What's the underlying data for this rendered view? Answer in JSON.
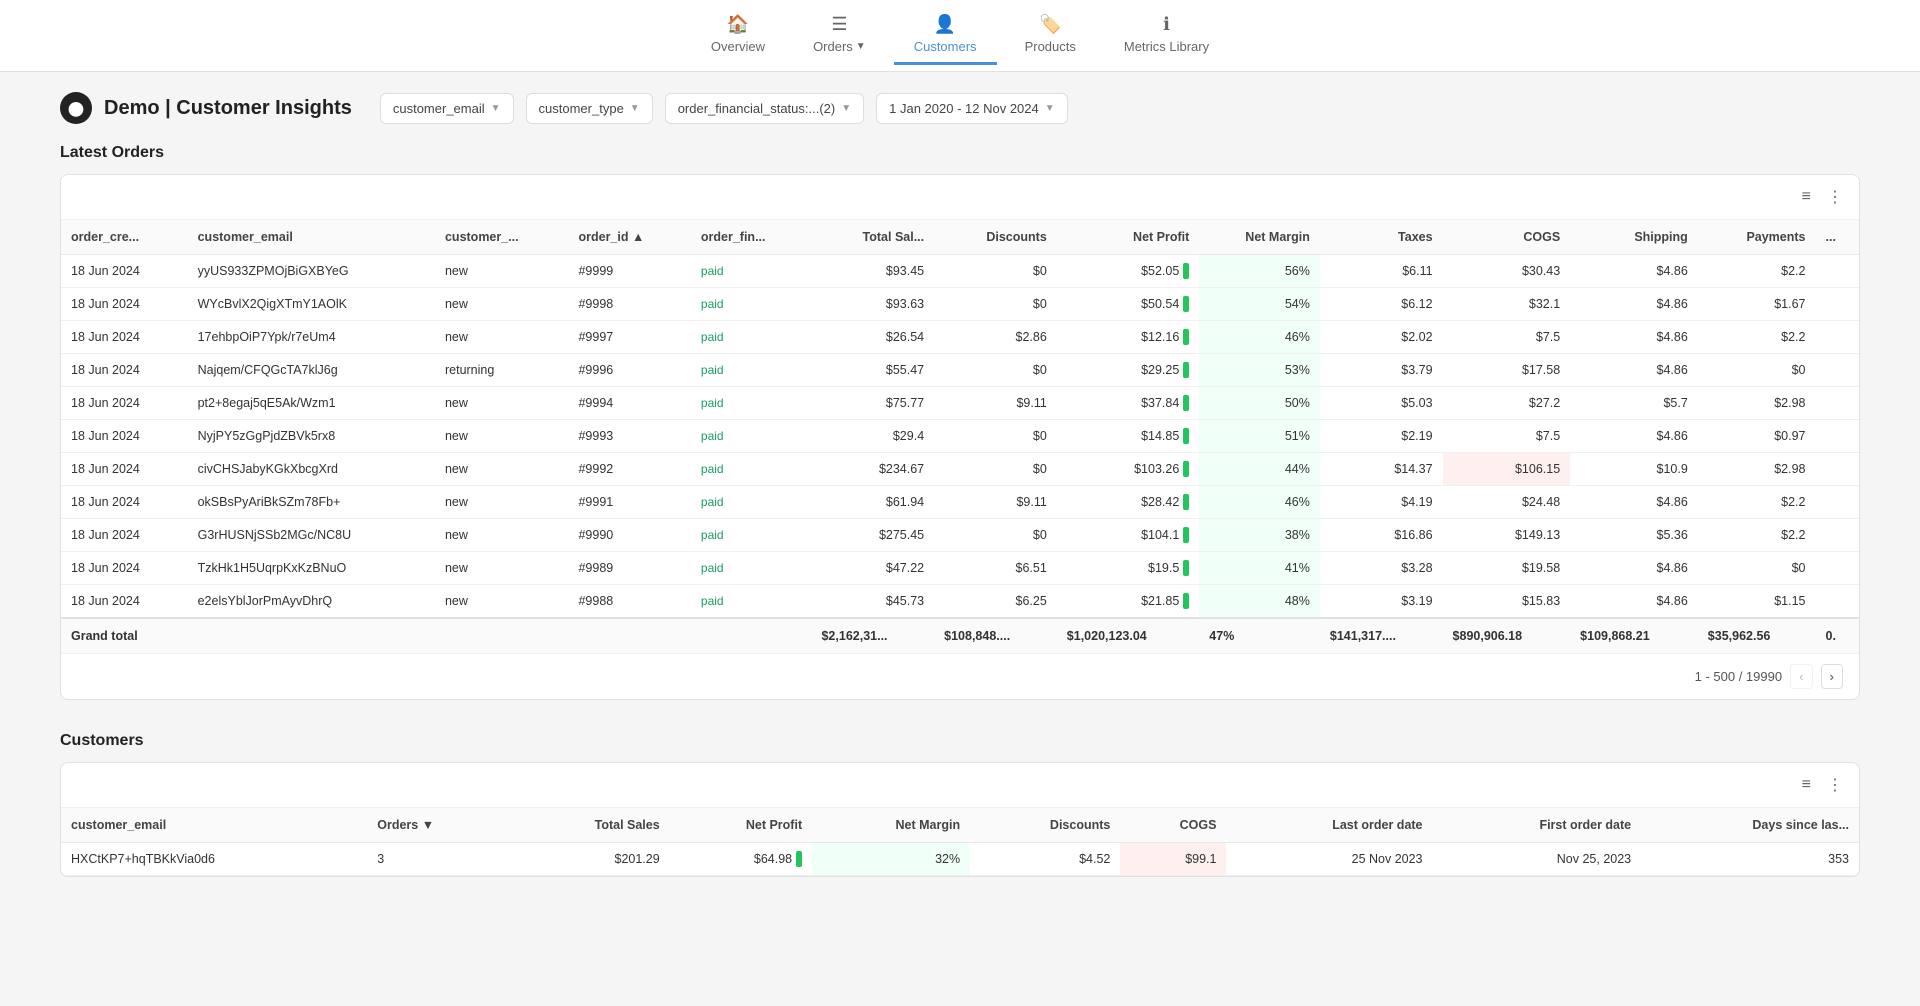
{
  "nav": {
    "items": [
      {
        "id": "overview",
        "label": "Overview",
        "icon": "🏠",
        "active": false
      },
      {
        "id": "orders",
        "label": "Orders",
        "icon": "≡",
        "active": false,
        "hasDropdown": true
      },
      {
        "id": "customers",
        "label": "Customers",
        "icon": "👤",
        "active": true
      },
      {
        "id": "products",
        "label": "Products",
        "icon": "🏷️",
        "active": false
      },
      {
        "id": "metrics-library",
        "label": "Metrics Library",
        "icon": "ℹ",
        "active": false
      }
    ]
  },
  "header": {
    "logo": "⬤",
    "title": "Demo | Customer Insights",
    "filters": [
      {
        "id": "customer_email",
        "label": "customer_email"
      },
      {
        "id": "customer_type",
        "label": "customer_type"
      },
      {
        "id": "order_financial_status",
        "label": "order_financial_status:...(2)"
      },
      {
        "id": "date_range",
        "label": "1 Jan 2020 - 12 Nov 2024"
      }
    ]
  },
  "latest_orders": {
    "section_title": "Latest Orders",
    "toolbar": {
      "filter_icon": "≡",
      "more_icon": "⋮"
    },
    "columns": [
      {
        "id": "order_cre",
        "label": "order_cre..."
      },
      {
        "id": "customer_email",
        "label": "customer_email"
      },
      {
        "id": "customer_type",
        "label": "customer_..."
      },
      {
        "id": "order_id",
        "label": "order_id",
        "sortable": true
      },
      {
        "id": "order_fin",
        "label": "order_fin..."
      },
      {
        "id": "total_sales",
        "label": "Total Sal...",
        "right": true
      },
      {
        "id": "discounts",
        "label": "Discounts",
        "right": true
      },
      {
        "id": "net_profit",
        "label": "Net Profit",
        "right": true
      },
      {
        "id": "net_margin",
        "label": "Net Margin",
        "right": true
      },
      {
        "id": "taxes",
        "label": "Taxes",
        "right": true
      },
      {
        "id": "cogs",
        "label": "COGS",
        "right": true
      },
      {
        "id": "shipping",
        "label": "Shipping",
        "right": true
      },
      {
        "id": "payments",
        "label": "Payments",
        "right": true
      },
      {
        "id": "more",
        "label": "..."
      }
    ],
    "rows": [
      {
        "date": "18 Jun 2024",
        "email": "yyUS933ZPMOjBiGXBYeG",
        "type": "new",
        "order_id": "#9999",
        "fin_status": "paid",
        "total_sales": "$93.45",
        "discounts": "$0",
        "net_profit": "$52.05",
        "net_margin": "56%",
        "taxes": "$6.11",
        "cogs": "$30.43",
        "shipping": "$4.86",
        "payments": "$2.2",
        "bar": true
      },
      {
        "date": "18 Jun 2024",
        "email": "WYcBvlX2QigXTmY1AOlK",
        "type": "new",
        "order_id": "#9998",
        "fin_status": "paid",
        "total_sales": "$93.63",
        "discounts": "$0",
        "net_profit": "$50.54",
        "net_margin": "54%",
        "taxes": "$6.12",
        "cogs": "$32.1",
        "shipping": "$4.86",
        "payments": "$1.67",
        "bar": true
      },
      {
        "date": "18 Jun 2024",
        "email": "17ehbpOiP7Ypk/r7eUm4",
        "type": "new",
        "order_id": "#9997",
        "fin_status": "paid",
        "total_sales": "$26.54",
        "discounts": "$2.86",
        "net_profit": "$12.16",
        "net_margin": "46%",
        "taxes": "$2.02",
        "cogs": "$7.5",
        "shipping": "$4.86",
        "payments": "$2.2",
        "bar": true
      },
      {
        "date": "18 Jun 2024",
        "email": "Najqem/CFQGcTA7klJ6g",
        "type": "returning",
        "order_id": "#9996",
        "fin_status": "paid",
        "total_sales": "$55.47",
        "discounts": "$0",
        "net_profit": "$29.25",
        "net_margin": "53%",
        "taxes": "$3.79",
        "cogs": "$17.58",
        "shipping": "$4.86",
        "payments": "$0",
        "bar": true
      },
      {
        "date": "18 Jun 2024",
        "email": "pt2+8egaj5qE5Ak/Wzm1",
        "type": "new",
        "order_id": "#9994",
        "fin_status": "paid",
        "total_sales": "$75.77",
        "discounts": "$9.11",
        "net_profit": "$37.84",
        "net_margin": "50%",
        "taxes": "$5.03",
        "cogs": "$27.2",
        "shipping": "$5.7",
        "payments": "$2.98",
        "bar": true
      },
      {
        "date": "18 Jun 2024",
        "email": "NyjPY5zGgPjdZBVk5rx8",
        "type": "new",
        "order_id": "#9993",
        "fin_status": "paid",
        "total_sales": "$29.4",
        "discounts": "$0",
        "net_profit": "$14.85",
        "net_margin": "51%",
        "taxes": "$2.19",
        "cogs": "$7.5",
        "shipping": "$4.86",
        "payments": "$0.97",
        "bar": true
      },
      {
        "date": "18 Jun 2024",
        "email": "civCHSJabyKGkXbcgXrd",
        "type": "new",
        "order_id": "#9992",
        "fin_status": "paid",
        "total_sales": "$234.67",
        "discounts": "$0",
        "net_profit": "$103.26",
        "net_margin": "44%",
        "taxes": "$14.37",
        "cogs": "$106.15",
        "shipping": "$10.9",
        "payments": "$2.98",
        "bar": true,
        "cogs_highlight": true
      },
      {
        "date": "18 Jun 2024",
        "email": "okSBsPyAriBkSZm78Fb+",
        "type": "new",
        "order_id": "#9991",
        "fin_status": "paid",
        "total_sales": "$61.94",
        "discounts": "$9.11",
        "net_profit": "$28.42",
        "net_margin": "46%",
        "taxes": "$4.19",
        "cogs": "$24.48",
        "shipping": "$4.86",
        "payments": "$2.2",
        "bar": true
      },
      {
        "date": "18 Jun 2024",
        "email": "G3rHUSNjSSb2MGc/NC8U",
        "type": "new",
        "order_id": "#9990",
        "fin_status": "paid",
        "total_sales": "$275.45",
        "discounts": "$0",
        "net_profit": "$104.1",
        "net_margin": "38%",
        "taxes": "$16.86",
        "cogs": "$149.13",
        "shipping": "$5.36",
        "payments": "$2.2",
        "bar": true
      },
      {
        "date": "18 Jun 2024",
        "email": "TzkHk1H5UqrpKxKzBNuO",
        "type": "new",
        "order_id": "#9989",
        "fin_status": "paid",
        "total_sales": "$47.22",
        "discounts": "$6.51",
        "net_profit": "$19.5",
        "net_margin": "41%",
        "taxes": "$3.28",
        "cogs": "$19.58",
        "shipping": "$4.86",
        "payments": "$0",
        "bar": true
      },
      {
        "date": "18 Jun 2024",
        "email": "e2elsYblJorPmAyvDhrQ",
        "type": "new",
        "order_id": "#9988",
        "fin_status": "paid",
        "total_sales": "$45.73",
        "discounts": "$6.25",
        "net_profit": "$21.85",
        "net_margin": "48%",
        "taxes": "$3.19",
        "cogs": "$15.83",
        "shipping": "$4.86",
        "payments": "$1.15",
        "bar": true
      }
    ],
    "grand_total": {
      "label": "Grand total",
      "total_sales": "$2,162,31...",
      "discounts": "$108,848....",
      "net_profit": "$1,020,123.04",
      "net_margin": "47%",
      "taxes": "$141,317....",
      "cogs": "$890,906.18",
      "shipping": "$109,868.21",
      "payments": "$35,962.56",
      "extra": "0."
    },
    "pagination": {
      "info": "1 - 500 / 19990",
      "prev_label": "‹",
      "next_label": "›"
    }
  },
  "customers": {
    "section_title": "Customers",
    "toolbar": {
      "filter_icon": "≡",
      "more_icon": "⋮"
    },
    "columns": [
      {
        "id": "customer_email",
        "label": "customer_email"
      },
      {
        "id": "orders",
        "label": "Orders",
        "sortable": true
      },
      {
        "id": "total_sales",
        "label": "Total Sales",
        "right": true
      },
      {
        "id": "net_profit",
        "label": "Net Profit",
        "right": true
      },
      {
        "id": "net_margin",
        "label": "Net Margin",
        "right": true
      },
      {
        "id": "discounts",
        "label": "Discounts",
        "right": true
      },
      {
        "id": "cogs",
        "label": "COGS",
        "right": true
      },
      {
        "id": "last_order_date",
        "label": "Last order date",
        "right": true
      },
      {
        "id": "first_order_date",
        "label": "First order date",
        "right": true
      },
      {
        "id": "days_since_last",
        "label": "Days since las...",
        "right": true
      }
    ],
    "rows": [
      {
        "email": "HXCtKP7+hqTBKkVia0d6",
        "orders": "3",
        "total_sales": "$201.29",
        "net_profit": "$64.98",
        "net_margin": "32%",
        "discounts": "$4.52",
        "cogs": "$99.1",
        "last_order_date": "25 Nov 2023",
        "first_order_date": "Nov 25, 2023",
        "days_since_last": "353",
        "bar": true,
        "cogs_highlight": true
      }
    ]
  }
}
